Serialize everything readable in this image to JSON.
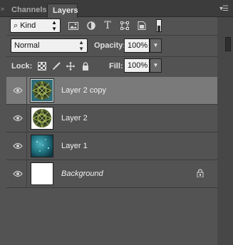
{
  "tabs": [
    {
      "label": "Channels"
    },
    {
      "label": "Layers"
    }
  ],
  "filter": {
    "kind_label": "Kind",
    "icons": [
      "image-filter-icon",
      "adjustment-filter-icon",
      "type-filter-icon",
      "shape-filter-icon",
      "smart-object-filter-icon"
    ]
  },
  "blend": {
    "mode": "Normal",
    "opacity_label": "Opacity:",
    "opacity_value": "100%",
    "fill_label": "Fill:",
    "fill_value": "100%"
  },
  "lock": {
    "label": "Lock:"
  },
  "layers": [
    {
      "name": "Layer 2 copy",
      "selected": true,
      "thumb": "kaleidoscope",
      "italic": false
    },
    {
      "name": "Layer 2",
      "selected": false,
      "thumb": "kaleidoscope",
      "italic": false
    },
    {
      "name": "Layer 1",
      "selected": false,
      "thumb": "teal-texture",
      "italic": false
    },
    {
      "name": "Background",
      "selected": false,
      "thumb": "white",
      "italic": true,
      "locked": true
    }
  ],
  "colors": {
    "panel_bg": "#535353",
    "selected_row": "#7a7a7a",
    "tabbar_bg": "#3c3c3c"
  }
}
